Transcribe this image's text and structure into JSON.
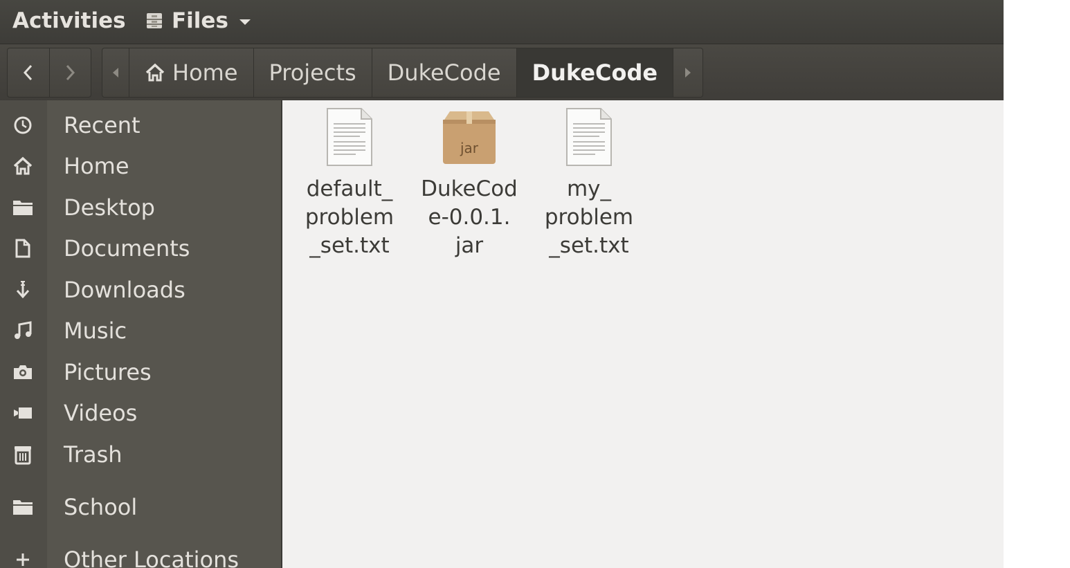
{
  "topbar": {
    "activities": "Activities",
    "app_name": "Files"
  },
  "breadcrumb": [
    "Home",
    "Projects",
    "DukeCode",
    "DukeCode"
  ],
  "sidebar": {
    "items": [
      {
        "label": "Recent",
        "icon": "clock-icon"
      },
      {
        "label": "Home",
        "icon": "home-icon"
      },
      {
        "label": "Desktop",
        "icon": "folder-icon"
      },
      {
        "label": "Documents",
        "icon": "document-icon"
      },
      {
        "label": "Downloads",
        "icon": "download-arrow-icon"
      },
      {
        "label": "Music",
        "icon": "music-note-icon"
      },
      {
        "label": "Pictures",
        "icon": "camera-icon"
      },
      {
        "label": "Videos",
        "icon": "video-icon"
      },
      {
        "label": "Trash",
        "icon": "trash-icon"
      },
      {
        "label": "School",
        "icon": "folder-icon"
      },
      {
        "label": "Other Locations",
        "icon": "plus-icon"
      }
    ]
  },
  "files": [
    {
      "line1": "default_",
      "line2": "problem",
      "line3": "_set.txt",
      "type": "text-file-icon"
    },
    {
      "line1": "DukeCod",
      "line2": "e-0.0.1.",
      "line3": "jar",
      "type": "jar-archive-icon",
      "badge": "jar"
    },
    {
      "line1": "my_",
      "line2": "problem",
      "line3": "_set.txt",
      "type": "text-file-icon"
    }
  ]
}
